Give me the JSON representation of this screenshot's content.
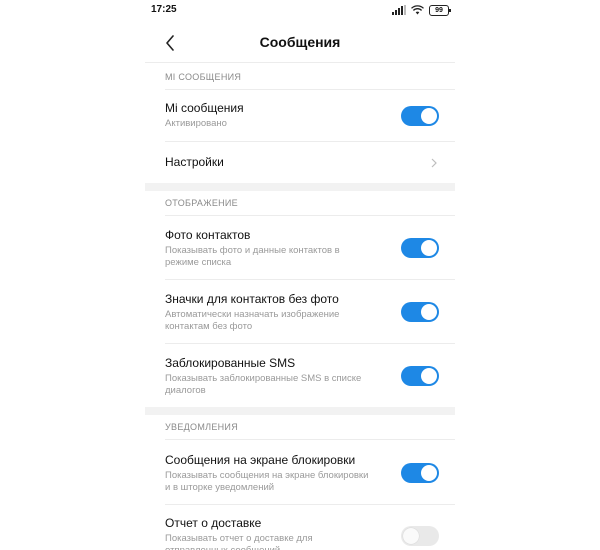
{
  "status": {
    "time": "17:25",
    "battery": "99"
  },
  "header": {
    "title": "Сообщения"
  },
  "sections": {
    "mi": "MI СООБЩЕНИЯ",
    "display": "ОТОБРАЖЕНИЕ",
    "notifications": "УВЕДОМЛЕНИЯ"
  },
  "rows": {
    "mi_messages": {
      "title": "Mi сообщения",
      "subtitle": "Активировано",
      "enabled": true
    },
    "settings": {
      "title": "Настройки"
    },
    "contact_photos": {
      "title": "Фото контактов",
      "subtitle": "Показывать фото и данные контактов в режиме списка",
      "enabled": true
    },
    "contact_badges": {
      "title": "Значки для контактов без фото",
      "subtitle": "Автоматически назначать изображение контактам без фото",
      "enabled": true
    },
    "blocked_sms": {
      "title": "Заблокированные SMS",
      "subtitle": "Показывать заблокированные SMS в списке диалогов",
      "enabled": true
    },
    "lockscreen_messages": {
      "title": "Сообщения на экране блокировки",
      "subtitle": "Показывать сообщения на экране блокировки и в шторке уведомлений",
      "enabled": true
    },
    "delivery_report": {
      "title": "Отчет о доставке",
      "subtitle": "Показывать отчет о доставке для отправленных сообщений",
      "enabled": false
    }
  },
  "colors": {
    "accent": "#1e88e5",
    "toggle_off": "#e9e9e9"
  }
}
